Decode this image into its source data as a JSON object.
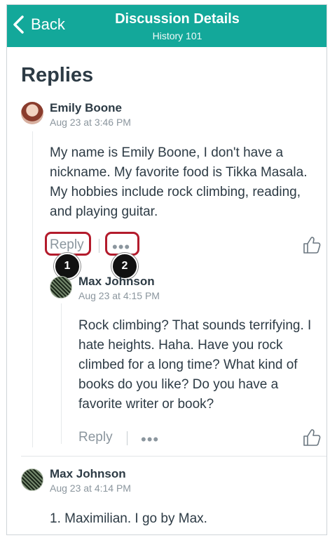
{
  "navbar": {
    "back_label": "Back",
    "title": "Discussion Details",
    "subtitle": "History 101",
    "color": "#13a89a"
  },
  "section_title": "Replies",
  "replies": [
    {
      "author": "Emily Boone",
      "date": "Aug 23 at 3:46 PM",
      "message": "My name is Emily Boone, I don't have a nickname. My favorite food is Tikka Masala. My hobbies include rock climbing, reading, and playing guitar.",
      "reply_label": "Reply",
      "more_label": "•••",
      "avatar_icon": "user-photo",
      "nested": {
        "author": "Max Johnson",
        "date": "Aug 23 at 4:15 PM",
        "message": "Rock climbing? That sounds terrifying. I hate heights. Haha. Have you rock climbed for a long time? What kind of books do you like? Do you have a favorite writer or book?",
        "reply_label": "Reply",
        "more_label": "•••"
      }
    },
    {
      "author": "Max Johnson",
      "date": "Aug 23 at 4:14 PM",
      "message": "1. Maximilian. I go by Max."
    }
  ],
  "annotations": {
    "marker_1": "1",
    "marker_2": "2",
    "highlight_color": "#b31b2c"
  }
}
